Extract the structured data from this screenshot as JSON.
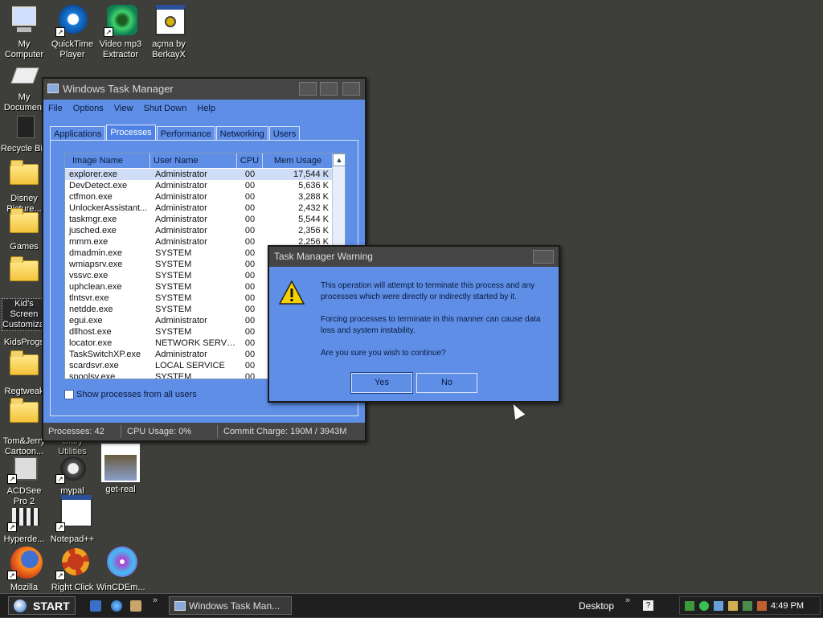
{
  "desktop": {
    "icons": [
      {
        "label": "My Computer",
        "icon": "computer-icon"
      },
      {
        "label": "QuickTime Player",
        "icon": "quicktime-icon"
      },
      {
        "label": "Video mp3 Extractor",
        "icon": "video-mp3-extractor-icon"
      },
      {
        "label": "açma by BerkayX",
        "icon": "program-window-icon"
      },
      {
        "label": "My Document",
        "icon": "documents-icon"
      },
      {
        "label": "Recycle Bin",
        "icon": "recycle-bin-icon"
      },
      {
        "label": "Disney Picture...",
        "icon": "folder-icon"
      },
      {
        "label": "Games",
        "icon": "folder-icon"
      },
      {
        "label": "Kid's Screen Customizaon",
        "icon": "folder-icon"
      },
      {
        "label": "KidsProgs",
        "icon": "folder-icon"
      },
      {
        "label": "Regtweak",
        "icon": "folder-icon"
      },
      {
        "label": "Tom&Jerry Cartoon...",
        "icon": "folder-icon"
      },
      {
        "label": "Glary Utilities",
        "icon": "glary-utilities-icon"
      },
      {
        "label": "ACDSee Pro 2",
        "icon": "acdsee-icon"
      },
      {
        "label": "mypal",
        "icon": "mypal-icon"
      },
      {
        "label": "get-real",
        "icon": "image-icon"
      },
      {
        "label": "Hyperde...",
        "icon": "hyperdesk-icon"
      },
      {
        "label": "Notepad++",
        "icon": "notepad-icon"
      },
      {
        "label": "Mozilla",
        "icon": "firefox-icon"
      },
      {
        "label": "Right Click",
        "icon": "gear-icon"
      },
      {
        "label": "WinCDEm...",
        "icon": "cd-icon"
      }
    ]
  },
  "task_manager": {
    "title": "Windows Task Manager",
    "menu": [
      "File",
      "Options",
      "View",
      "Shut Down",
      "Help"
    ],
    "tabs": [
      "Applications",
      "Processes",
      "Performance",
      "Networking",
      "Users"
    ],
    "active_tab": "Processes",
    "columns": [
      "Image Name",
      "User Name",
      "CPU",
      "Mem Usage"
    ],
    "processes": [
      {
        "name": "explorer.exe",
        "user": "Administrator",
        "cpu": "00",
        "mem": "17,544 K"
      },
      {
        "name": "DevDetect.exe",
        "user": "Administrator",
        "cpu": "00",
        "mem": "5,636 K"
      },
      {
        "name": "ctfmon.exe",
        "user": "Administrator",
        "cpu": "00",
        "mem": "3,288 K"
      },
      {
        "name": "UnlockerAssistant...",
        "user": "Administrator",
        "cpu": "00",
        "mem": "2,432 K"
      },
      {
        "name": "taskmgr.exe",
        "user": "Administrator",
        "cpu": "00",
        "mem": "5,544 K"
      },
      {
        "name": "jusched.exe",
        "user": "Administrator",
        "cpu": "00",
        "mem": "2,356 K"
      },
      {
        "name": "mmm.exe",
        "user": "Administrator",
        "cpu": "00",
        "mem": "2,256 K"
      },
      {
        "name": "dmadmin.exe",
        "user": "SYSTEM",
        "cpu": "00",
        "mem": ""
      },
      {
        "name": "wmiapsrv.exe",
        "user": "SYSTEM",
        "cpu": "00",
        "mem": ""
      },
      {
        "name": "vssvc.exe",
        "user": "SYSTEM",
        "cpu": "00",
        "mem": ""
      },
      {
        "name": "uphclean.exe",
        "user": "SYSTEM",
        "cpu": "00",
        "mem": ""
      },
      {
        "name": "tlntsvr.exe",
        "user": "SYSTEM",
        "cpu": "00",
        "mem": ""
      },
      {
        "name": "netdde.exe",
        "user": "SYSTEM",
        "cpu": "00",
        "mem": ""
      },
      {
        "name": "egui.exe",
        "user": "Administrator",
        "cpu": "00",
        "mem": ""
      },
      {
        "name": "dllhost.exe",
        "user": "SYSTEM",
        "cpu": "00",
        "mem": ""
      },
      {
        "name": "locator.exe",
        "user": "NETWORK SERVICE",
        "cpu": "00",
        "mem": ""
      },
      {
        "name": "TaskSwitchXP.exe",
        "user": "Administrator",
        "cpu": "00",
        "mem": ""
      },
      {
        "name": "scardsvr.exe",
        "user": "LOCAL SERVICE",
        "cpu": "00",
        "mem": ""
      },
      {
        "name": "spoolsv.exe",
        "user": "SYSTEM",
        "cpu": "00",
        "mem": ""
      }
    ],
    "show_all_label": "Show processes from all users",
    "status": {
      "processes": "Processes: 42",
      "cpu": "CPU Usage: 0%",
      "commit": "Commit Charge: 190M / 3943M"
    }
  },
  "warning_dialog": {
    "title": "Task Manager Warning",
    "line1": "This operation will attempt to terminate this process and any processes which were directly or indirectly started by it.",
    "line2": "Forcing processes to terminate in this manner can cause data loss and system instability.",
    "line3": "Are you sure you wish to continue?",
    "yes_label": "Yes",
    "no_label": "No"
  },
  "taskbar": {
    "start_label": "START",
    "window_button": "Windows Task Man...",
    "toolbar_label": "Desktop",
    "clock": "4:49 PM"
  }
}
